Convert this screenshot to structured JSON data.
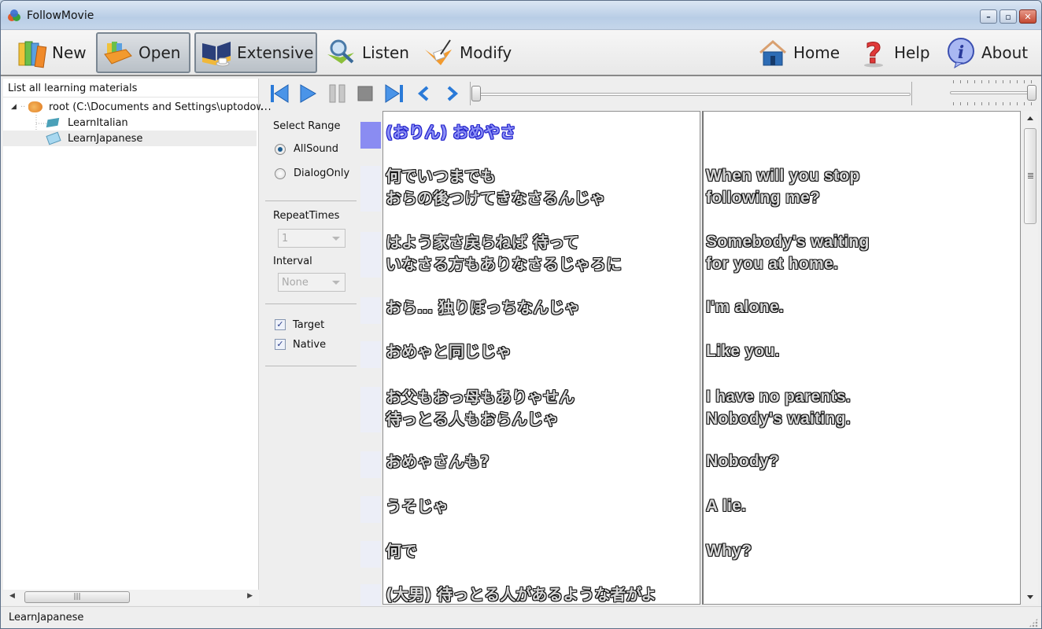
{
  "window": {
    "title": "FollowMovie",
    "controls": {
      "minimize": "minimize",
      "maximize": "maximize",
      "close": "close"
    }
  },
  "toolbar": {
    "left": [
      {
        "label": "New",
        "icon": "books-icon",
        "pressed": false
      },
      {
        "label": "Open",
        "icon": "open-folder-books-icon",
        "pressed": true
      },
      {
        "label": "Extensive",
        "icon": "book-coffee-icon",
        "pressed": true
      },
      {
        "label": "Listen",
        "icon": "magnifier-book-icon",
        "pressed": false
      },
      {
        "label": "Modify",
        "icon": "folder-pen-icon",
        "pressed": false
      }
    ],
    "right": [
      {
        "label": "Home",
        "icon": "home-icon"
      },
      {
        "label": "Help",
        "icon": "help-icon"
      },
      {
        "label": "About",
        "icon": "info-icon"
      }
    ]
  },
  "left_panel": {
    "header": "List all learning materials",
    "tree": {
      "root": "root (C:\\Documents and Settings\\uptodown-",
      "children": [
        {
          "label": "LearnItalian",
          "selected": false
        },
        {
          "label": "LearnJapanese",
          "selected": true
        }
      ]
    }
  },
  "player": {
    "buttons": [
      "skip-to-start",
      "play",
      "pause",
      "stop",
      "skip-to-end",
      "previous",
      "next"
    ],
    "position": 0,
    "volume": 1.0
  },
  "settings": {
    "select_range_label": "Select Range",
    "range_options": [
      {
        "label": "AllSound",
        "checked": true
      },
      {
        "label": "DialogOnly",
        "checked": false
      }
    ],
    "repeat_times_label": "RepeatTimes",
    "repeat_times_value": "1",
    "interval_label": "Interval",
    "interval_value": "None",
    "show_options": [
      {
        "label": "Target",
        "checked": true
      },
      {
        "label": "Native",
        "checked": true
      }
    ]
  },
  "subtitles": [
    {
      "target": "(おりん) おめやさ",
      "native": "",
      "active": true
    },
    {
      "target": "何でいつまでも\nおらの後つけてきなさるんじゃ",
      "native": "When will you stop\nfollowing me?"
    },
    {
      "target": "はよう家さ戻らねば 待って\nいなさる方もありなさるじゃろに",
      "native": "Somebody's waiting\nfor you at home."
    },
    {
      "target": "おら… 独りぼっちなんじゃ",
      "native": "I'm alone."
    },
    {
      "target": "おめゃと同じじゃ",
      "native": "Like you."
    },
    {
      "target": "お父もおっ母もありゃせん\n待っとる人もおらんじゃ",
      "native": "I have no parents.\nNobody's waiting."
    },
    {
      "target": "おめゃさんも?",
      "native": "Nobody?"
    },
    {
      "target": "うそじゃ",
      "native": "A lie."
    },
    {
      "target": "何で",
      "native": "Why?"
    },
    {
      "target": "(大男) 待っとる人があるような者がよ",
      "native": ""
    }
  ],
  "status": {
    "text": "LearnJapanese"
  }
}
